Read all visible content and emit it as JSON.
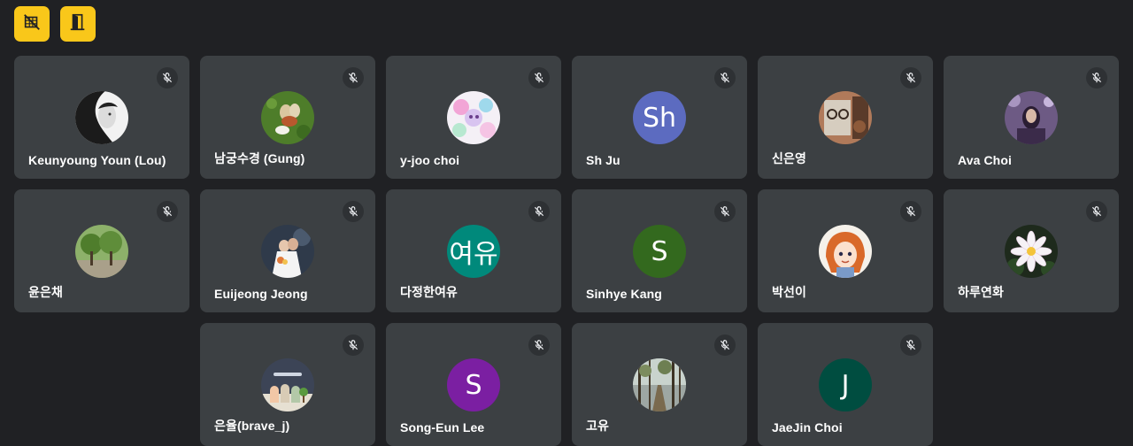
{
  "toolbar": {
    "buttons": [
      {
        "icon": "camera-off-grid-icon"
      },
      {
        "icon": "door-exit-icon"
      }
    ],
    "accent": "#f9c71a"
  },
  "participants": [
    {
      "name": "Keunyoung Youn (Lou)",
      "initials": "",
      "avatar_color": "",
      "muted": true
    },
    {
      "name": "남궁수경 (Gung)",
      "initials": "",
      "avatar_color": "",
      "muted": true
    },
    {
      "name": "y-joo choi",
      "initials": "",
      "avatar_color": "",
      "muted": true
    },
    {
      "name": "Sh Ju",
      "initials": "Sh",
      "avatar_color": "#5c6bc0",
      "muted": true
    },
    {
      "name": "신은영",
      "initials": "",
      "avatar_color": "",
      "muted": true
    },
    {
      "name": "Ava Choi",
      "initials": "",
      "avatar_color": "",
      "muted": true
    },
    {
      "name": "윤은채",
      "initials": "",
      "avatar_color": "",
      "muted": true
    },
    {
      "name": "Euijeong Jeong",
      "initials": "",
      "avatar_color": "",
      "muted": true
    },
    {
      "name": "다정한여유",
      "initials": "여유",
      "avatar_color": "#00897b",
      "muted": true
    },
    {
      "name": "Sinhye Kang",
      "initials": "S",
      "avatar_color": "#33691e",
      "muted": true
    },
    {
      "name": "박선이",
      "initials": "",
      "avatar_color": "",
      "muted": true
    },
    {
      "name": "하루연화",
      "initials": "",
      "avatar_color": "",
      "muted": true
    },
    {
      "name": "은율(brave_j)",
      "initials": "",
      "avatar_color": "",
      "muted": true
    },
    {
      "name": "Song-Eun Lee",
      "initials": "S",
      "avatar_color": "#7b1fa2",
      "muted": true
    },
    {
      "name": "고유",
      "initials": "",
      "avatar_color": "",
      "muted": true
    },
    {
      "name": "JaeJin Choi",
      "initials": "J",
      "avatar_color": "#004d40",
      "muted": true
    }
  ]
}
